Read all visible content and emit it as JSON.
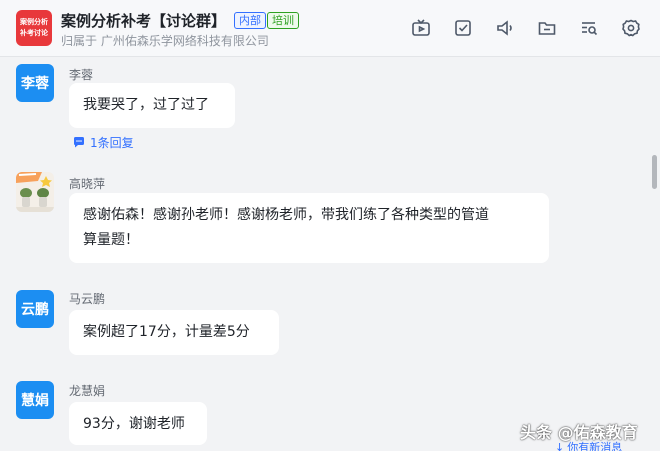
{
  "header": {
    "logo_line1": "案例分析",
    "logo_line2": "补考讨论",
    "title": "案例分析补考【讨论群】",
    "tag_internal": "内部",
    "tag_training": "培训",
    "org": "归属于 广州佑森乐学网络科技有限公司",
    "icons": [
      "tv-icon",
      "checkbox-icon",
      "announcement-icon",
      "folder-icon",
      "search-list-icon",
      "settings-icon"
    ]
  },
  "messages": [
    {
      "avatar_text": "李蓉",
      "sender": "李蓉",
      "text": "我要哭了，过了过了",
      "reply": "1条回复"
    },
    {
      "avatar_text": "",
      "sender": "高晓萍",
      "text_line1": "感谢佑森！感谢孙老师！感谢杨老师，带我们练了各种类型的管道",
      "text_line2": "算量题！"
    },
    {
      "avatar_text": "云鹏",
      "sender": "马云鹏",
      "text": "案例超了17分，计量差5分"
    },
    {
      "avatar_text": "慧娟",
      "sender": "龙慧娟",
      "text": "93分，谢谢老师"
    }
  ],
  "watermark": "头条 @佑森教育",
  "new_message": "你有新消息",
  "colors": {
    "accent": "#3370ff",
    "avatar_blue": "#1c8ef2",
    "logo_red": "#e8383b",
    "background": "#f2f3f5"
  }
}
